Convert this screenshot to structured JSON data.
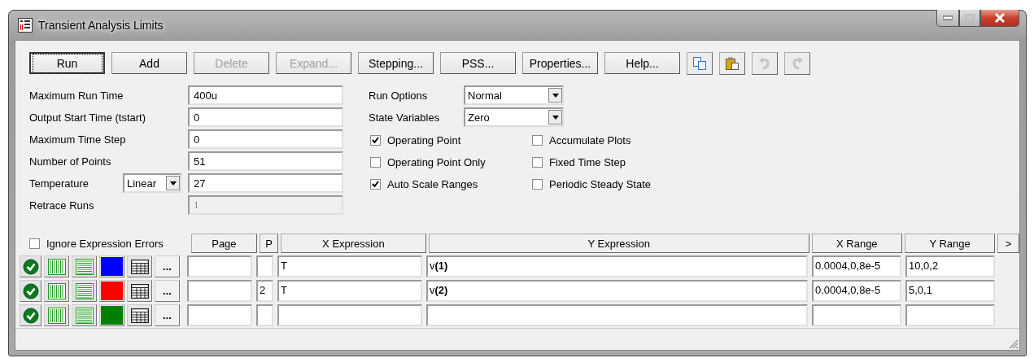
{
  "window": {
    "title": "Transient Analysis Limits"
  },
  "toolbar": {
    "buttons": [
      {
        "label": "Run",
        "disabled": false,
        "focused": true
      },
      {
        "label": "Add",
        "disabled": false,
        "focused": false
      },
      {
        "label": "Delete",
        "disabled": true,
        "focused": false
      },
      {
        "label": "Expand...",
        "disabled": true,
        "focused": false
      },
      {
        "label": "Stepping...",
        "disabled": false,
        "focused": false
      },
      {
        "label": "PSS...",
        "disabled": false,
        "focused": false
      },
      {
        "label": "Properties...",
        "disabled": false,
        "focused": false
      },
      {
        "label": "Help...",
        "disabled": false,
        "focused": false
      }
    ],
    "icon_buttons": [
      {
        "kind": "copy",
        "disabled": false
      },
      {
        "kind": "paste",
        "disabled": false
      },
      {
        "kind": "undo",
        "disabled": true
      },
      {
        "kind": "redo",
        "disabled": true
      }
    ]
  },
  "fields": [
    {
      "label": "Maximum Run Time",
      "value": "400u",
      "disabled": false
    },
    {
      "label": "Output Start Time (tstart)",
      "value": "0",
      "disabled": false
    },
    {
      "label": "Maximum Time Step",
      "value": "0",
      "disabled": false
    },
    {
      "label": "Number of Points",
      "value": "51",
      "disabled": false
    },
    {
      "label": "Temperature",
      "mode": "Linear",
      "value": "27",
      "disabled": false
    },
    {
      "label": "Retrace Runs",
      "value": "1",
      "disabled": true
    }
  ],
  "dropdowns": [
    {
      "label": "Run Options",
      "value": "Normal"
    },
    {
      "label": "State Variables",
      "value": "Zero"
    }
  ],
  "checkboxes": [
    {
      "label": "Operating Point",
      "checked": true
    },
    {
      "label": "Operating Point Only",
      "checked": false
    },
    {
      "label": "Auto Scale Ranges",
      "checked": true
    },
    {
      "label": "Accumulate Plots",
      "checked": false
    },
    {
      "label": "Fixed Time Step",
      "checked": false
    },
    {
      "label": "Periodic Steady State",
      "checked": false
    }
  ],
  "grid": {
    "ignore_errors": {
      "label": "Ignore Expression Errors",
      "checked": false
    },
    "columns": [
      "Page",
      "P",
      "X Expression",
      "Y Expression",
      "X Range",
      "Y Range"
    ],
    "more_columns": ">",
    "rows": [
      {
        "enabled": true,
        "color": "#0000ff",
        "more": "...",
        "x_expression": "T",
        "y_expression": "v**(1)**",
        "x_range": "0.0004,0,8e-5",
        "y_range": "10,0,2"
      },
      {
        "enabled": true,
        "color": "#ff0000",
        "more": "...",
        "p": "2",
        "x_expression": "T",
        "y_expression": "v**(2)**",
        "x_range": "0.0004,0,8e-5",
        "y_range": "5,0,1"
      },
      {
        "enabled": true,
        "color": "#008000",
        "more": "..."
      }
    ]
  }
}
